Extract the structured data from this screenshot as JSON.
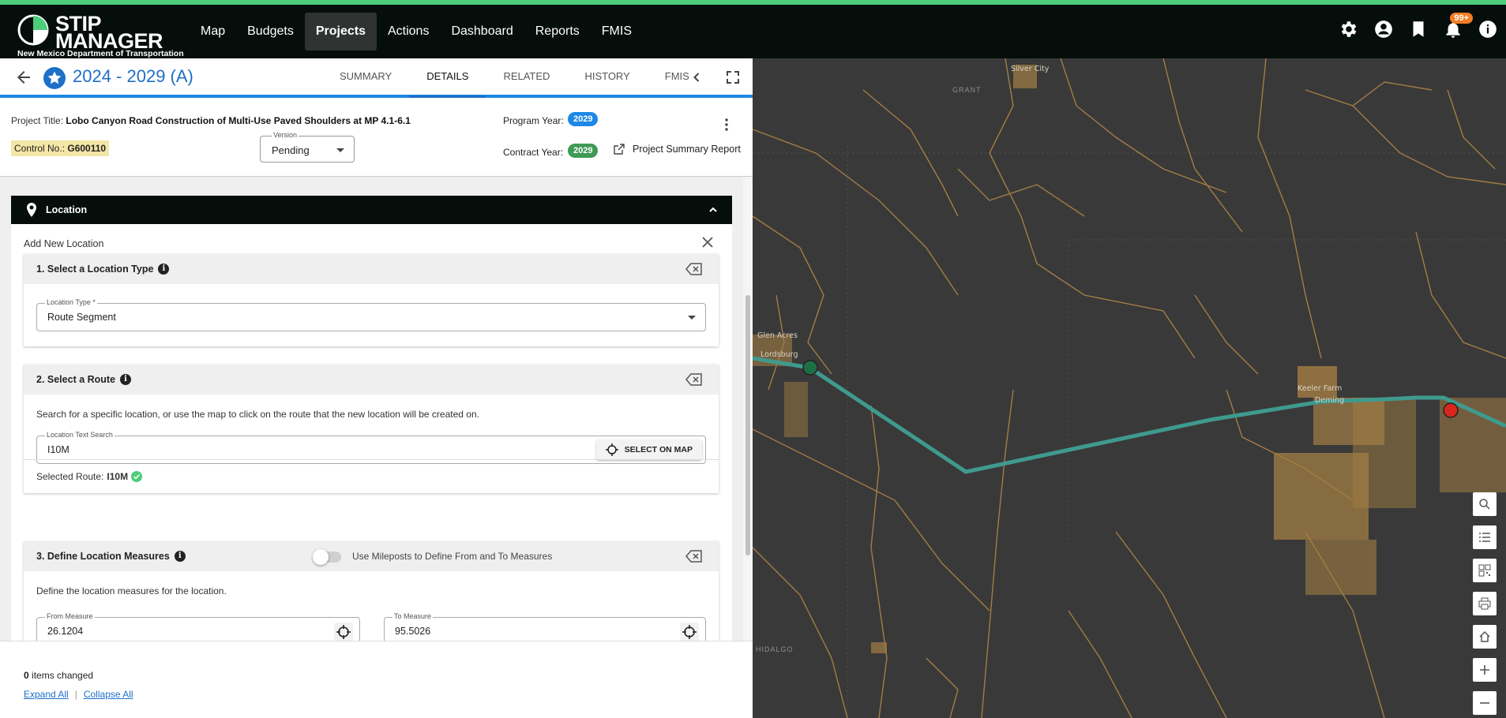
{
  "app": {
    "name_line1": "STIP",
    "name_line2": "MANAGER",
    "subtitle": "New Mexico Department of Transportation"
  },
  "nav": {
    "items": [
      {
        "label": "Map"
      },
      {
        "label": "Budgets"
      },
      {
        "label": "Projects",
        "active": true
      },
      {
        "label": "Actions"
      },
      {
        "label": "Dashboard"
      },
      {
        "label": "Reports"
      },
      {
        "label": "FMIS"
      }
    ],
    "icons": [
      "gear-icon",
      "account-icon",
      "bookmark-icon",
      "bell-icon",
      "info-icon"
    ],
    "notification_count": "99+"
  },
  "project": {
    "title_heading": "2024 - 2029 (A)",
    "tabs": [
      {
        "label": "SUMMARY"
      },
      {
        "label": "DETAILS",
        "active": true
      },
      {
        "label": "RELATED"
      },
      {
        "label": "HISTORY"
      },
      {
        "label": "FMIS"
      }
    ],
    "project_title_label": "Project Title:",
    "project_title_value": "Lobo Canyon Road Construction of Multi-Use Paved Shoulders at MP 4.1-6.1",
    "control_label": "Control No.:",
    "control_value": "G600110",
    "version_label": "Version",
    "version_value": "Pending",
    "program_year_label": "Program Year:",
    "program_year_value": "2029",
    "contract_year_label": "Contract Year:",
    "contract_year_value": "2029",
    "summary_report_label": "Project Summary Report"
  },
  "location": {
    "section_title": "Location",
    "add_new_label": "Add New Location",
    "step1": {
      "title": "1. Select a Location Type",
      "field_label": "Location Type *",
      "field_value": "Route Segment"
    },
    "step2": {
      "title": "2. Select a Route",
      "instructions": "Search for a specific location, or use the map to click on the route that the new location will be created on.",
      "field_label": "Location Text Search",
      "field_value": "I10M",
      "select_on_map_label": "SELECT ON MAP",
      "selected_route_label": "Selected Route:",
      "selected_route_value": "I10M"
    },
    "step3": {
      "title": "3. Define Location Measures",
      "toggle_label": "Use Mileposts to Define From and To Measures",
      "instructions": "Define the location measures for the location.",
      "from_label": "From Measure",
      "from_value": "26.1204",
      "to_label": "To Measure",
      "to_value": "95.5026"
    }
  },
  "footer": {
    "changed_count": "0",
    "changed_label": "items changed",
    "expand_all": "Expand All",
    "collapse_all": "Collapse All"
  },
  "map": {
    "places": [
      "Silver City",
      "GRANT",
      "Glen Acres",
      "Lordsburg",
      "Keeler Farm",
      "Deming",
      "HIDALGO"
    ],
    "tools": [
      "search-icon",
      "list-icon",
      "qr-code-icon",
      "print-icon",
      "home-icon",
      "zoom-in-icon",
      "zoom-out-icon"
    ]
  },
  "colors": {
    "accent": "#1e88e5",
    "nav_bg": "#050e0a",
    "route": "#3f9a8e",
    "map_bg": "#393939",
    "road": "#b08a4a"
  }
}
